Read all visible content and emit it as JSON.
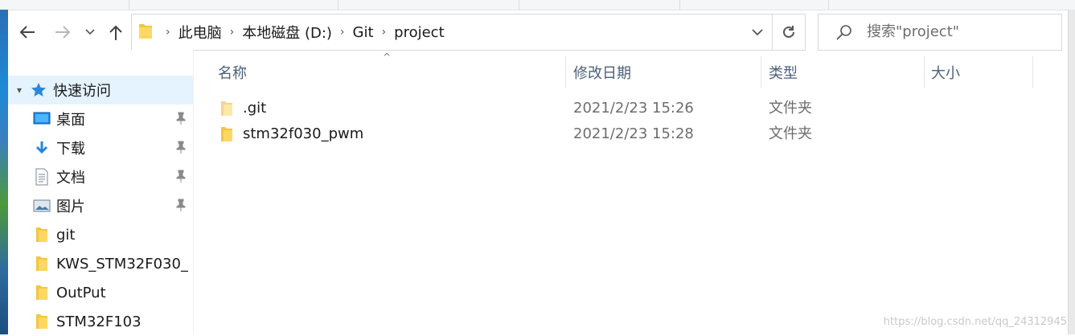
{
  "address_bar": {
    "crumbs": [
      "此电脑",
      "本地磁盘 (D:)",
      "Git",
      "project"
    ]
  },
  "search": {
    "placeholder": "搜索\"project\""
  },
  "nav_pane": {
    "quick_access": "快速访问",
    "items": [
      {
        "label": "桌面",
        "icon": "desktop-icon",
        "pinned": true
      },
      {
        "label": "下载",
        "icon": "download-icon",
        "pinned": true
      },
      {
        "label": "文档",
        "icon": "document-icon",
        "pinned": true
      },
      {
        "label": "图片",
        "icon": "pictures-icon",
        "pinned": true
      },
      {
        "label": "git",
        "icon": "folder-icon",
        "pinned": false
      },
      {
        "label": "KWS_STM32F030_",
        "icon": "folder-icon",
        "pinned": false
      },
      {
        "label": "OutPut",
        "icon": "folder-icon",
        "pinned": false
      },
      {
        "label": "STM32F103",
        "icon": "folder-icon",
        "pinned": false
      }
    ]
  },
  "columns": {
    "name": "名称",
    "modified": "修改日期",
    "type": "类型",
    "size": "大小"
  },
  "files": [
    {
      "name": ".git",
      "modified": "2021/2/23 15:26",
      "type": "文件夹"
    },
    {
      "name": "stm32f030_pwm",
      "modified": "2021/2/23 15:28",
      "type": "文件夹"
    }
  ],
  "watermark": "https://blog.csdn.net/qq_24312945",
  "colors": {
    "folder": "#f4c542",
    "selection": "#e5f3ff",
    "header_text": "#4c607a",
    "accent": "#1e88e5"
  }
}
